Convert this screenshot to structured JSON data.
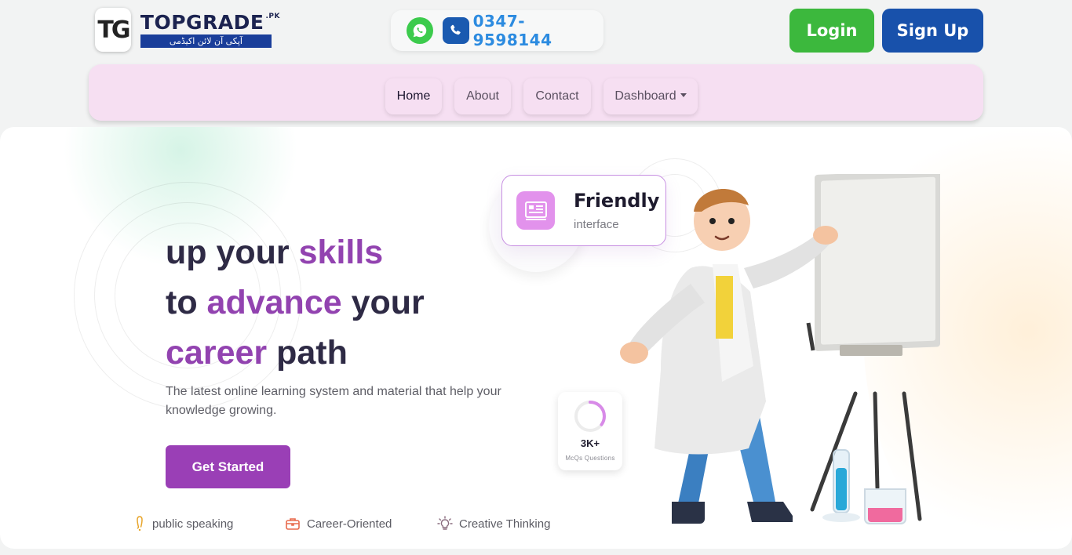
{
  "brand": {
    "mark": "TG",
    "name": "TOPGRADE",
    "tld": ".PK",
    "tagline_urdu": "آپکی آن لائن اکیڈمی"
  },
  "contact": {
    "whatsapp_icon": "whatsapp-icon",
    "phone_icon": "phone-icon",
    "phone": "0347-9598144"
  },
  "header": {
    "login_label": "Login",
    "signup_label": "Sign Up"
  },
  "nav": {
    "items": [
      {
        "label": "Home",
        "active": true
      },
      {
        "label": "About",
        "active": false
      },
      {
        "label": "Contact",
        "active": false
      },
      {
        "label": "Dashboard",
        "active": false,
        "dropdown": true
      }
    ]
  },
  "hero": {
    "line1_a": "up your ",
    "line1_b": "skills",
    "line2_a": "to ",
    "line2_b": "advance",
    "line2_c": " your",
    "line3_a": "career",
    "line3_b": " path",
    "description": "The latest online learning system and material that help your knowledge growing.",
    "cta_label": "Get Started"
  },
  "friendly_card": {
    "title": "Friendly",
    "subtitle": "interface",
    "icon": "interface-icon"
  },
  "stat_card": {
    "value": "3K+",
    "label": "McQs  Questions",
    "progress": 0.35
  },
  "features": [
    {
      "label": "public speaking",
      "icon": "microphone-icon"
    },
    {
      "label": "Career-Oriented",
      "icon": "briefcase-icon"
    },
    {
      "label": "Creative Thinking",
      "icon": "lightbulb-icon"
    }
  ],
  "colors": {
    "accent_purple": "#9a3fb6",
    "login_green": "#3cb83d",
    "signup_blue": "#1851ab",
    "nav_pink": "#f6dff2",
    "phone_text": "#2c8be0"
  }
}
